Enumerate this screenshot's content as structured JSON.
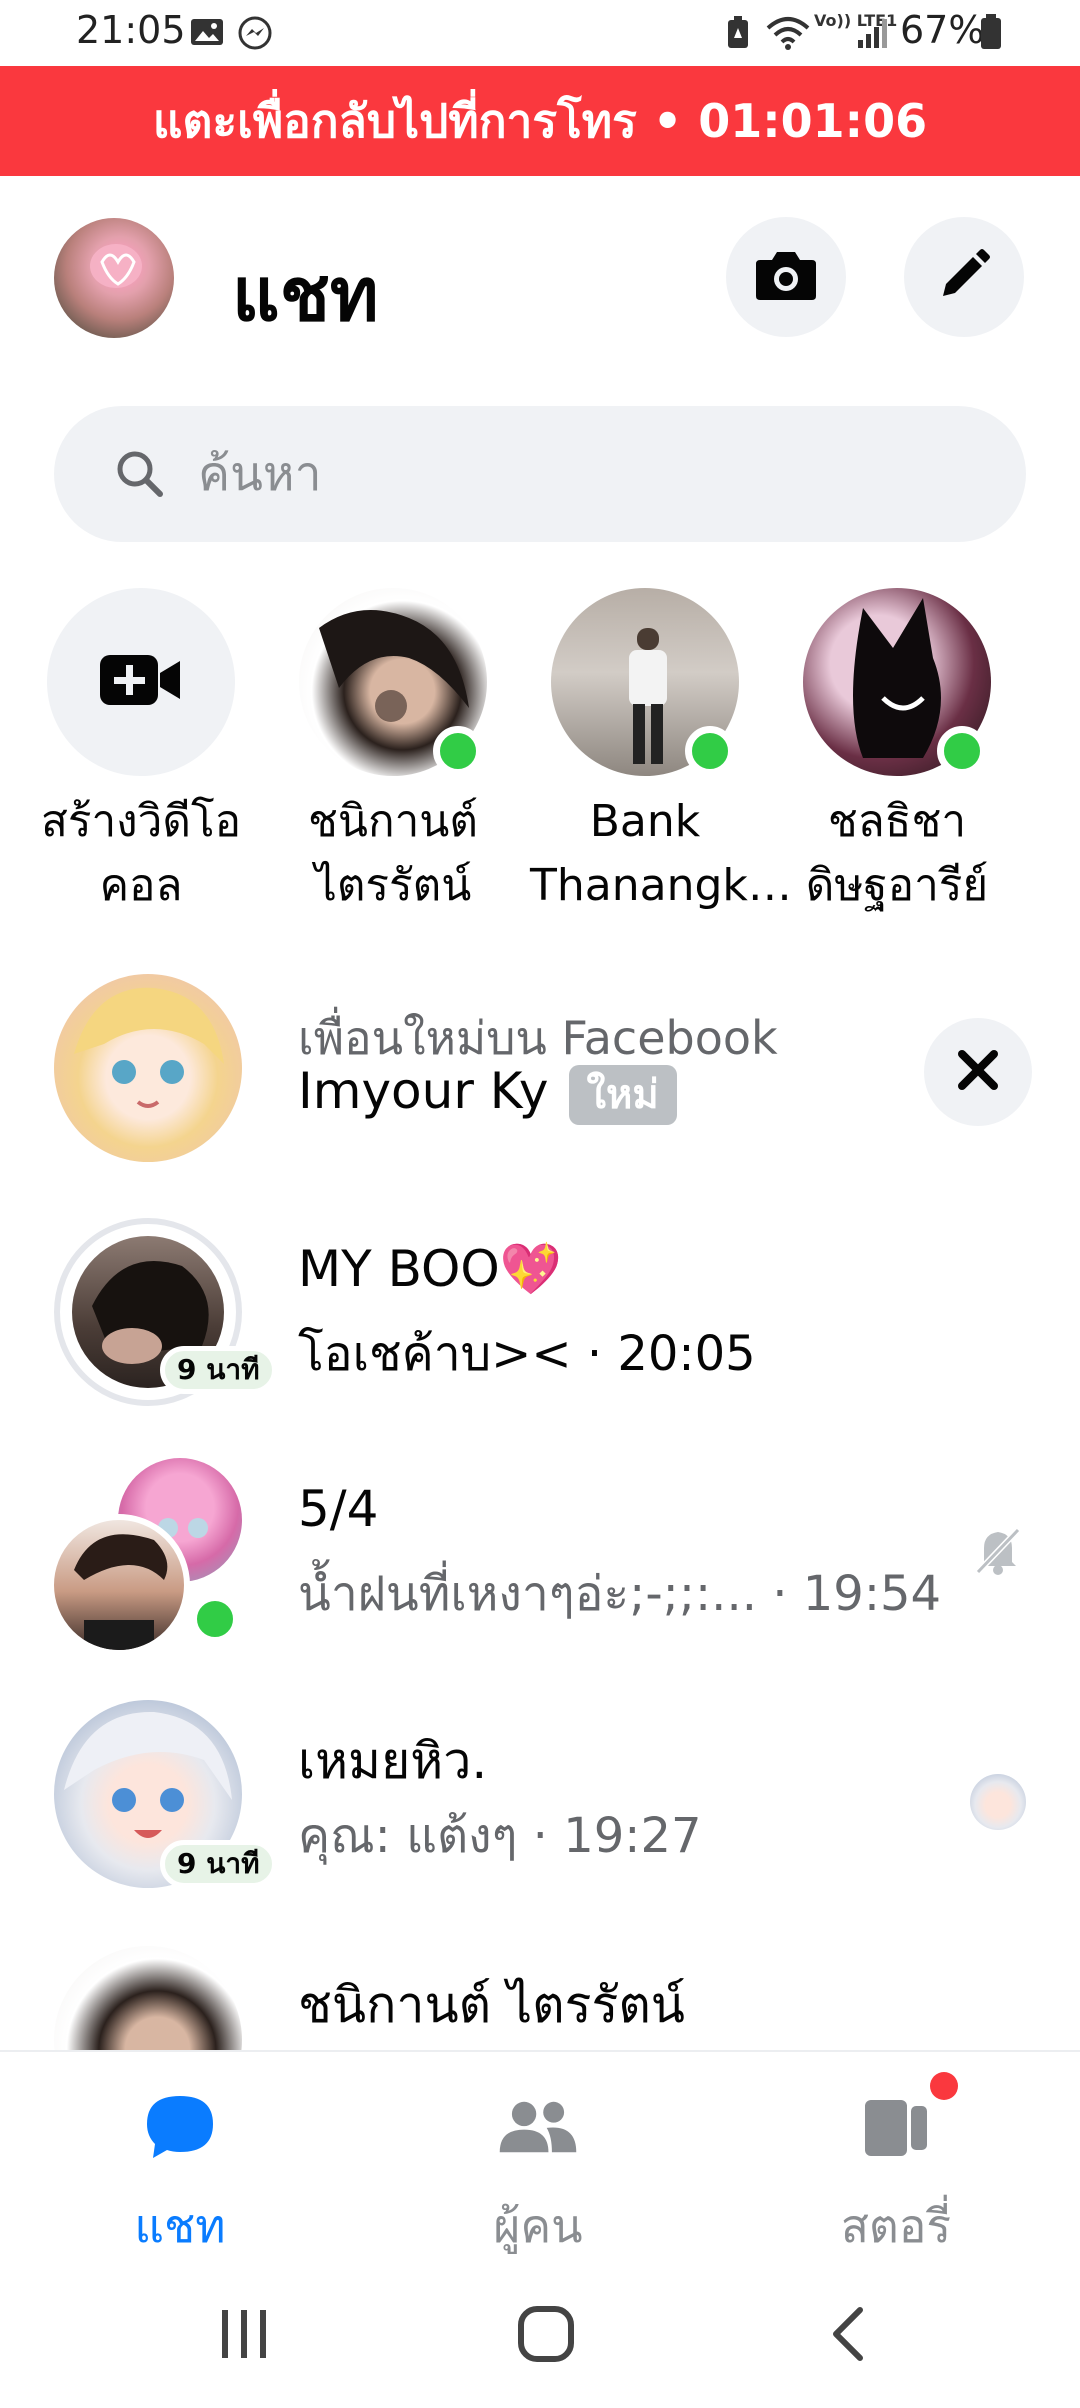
{
  "status_bar": {
    "time": "21:05",
    "battery": "67%",
    "icons": [
      "gallery-icon",
      "messenger-icon",
      "battery-saver-icon",
      "wifi-icon",
      "volte-icon",
      "signal-icon",
      "battery-icon"
    ],
    "volte_text": "Vo)) LTE1"
  },
  "call_banner": {
    "label": "แตะเพื่อกลับไปที่การโทร • 01:01:06",
    "color": "#fa383e"
  },
  "header": {
    "title": "แชท",
    "camera_icon": "camera-icon",
    "compose_icon": "pencil-icon"
  },
  "search": {
    "placeholder": "ค้นหา"
  },
  "active_people": [
    {
      "name": "สร้างวิดีโอคอล",
      "icon": "video-plus-icon"
    },
    {
      "name": "ชนิกานต์ ไตรรัตน์",
      "online": true
    },
    {
      "name": "Bank Thanangk…",
      "online": true
    },
    {
      "name": "ชลธิชา ดิษฐอารีย์",
      "online": true
    }
  ],
  "chats": [
    {
      "line1": "เพื่อนใหม่บน Facebook",
      "name": "Imyour Ky",
      "badge": "ใหม่",
      "dismiss_icon": "close-icon"
    },
    {
      "name": "MY BOO",
      "emoji": "💖",
      "preview": "โอเชค้าบ><",
      "time": "· 20:05",
      "story_time": "9 นาที"
    },
    {
      "name": "5/4",
      "preview": "น้ำฝนที่เหงาๆอ่ะ;-;;:...",
      "time": "· 19:54",
      "muted_icon": "bell-off-icon"
    },
    {
      "name": "เหมยหิว.",
      "preview": "คุณ: แต้งๆ",
      "time": "· 19:27",
      "story_time": "9 นาที"
    },
    {
      "name": "ชนิกานต์ ไตรรัตน์"
    }
  ],
  "bottom_nav": [
    {
      "label": "แชท",
      "icon": "chat-bubble-icon",
      "active": true
    },
    {
      "label": "ผู้คน",
      "icon": "people-icon",
      "active": false
    },
    {
      "label": "สตอรี่",
      "icon": "stories-icon",
      "active": false,
      "notification": true
    }
  ],
  "colors": {
    "accent": "#0a7cff",
    "online": "#31cc46",
    "inactive_nav": "#8a8d91",
    "banner": "#fa383e"
  }
}
